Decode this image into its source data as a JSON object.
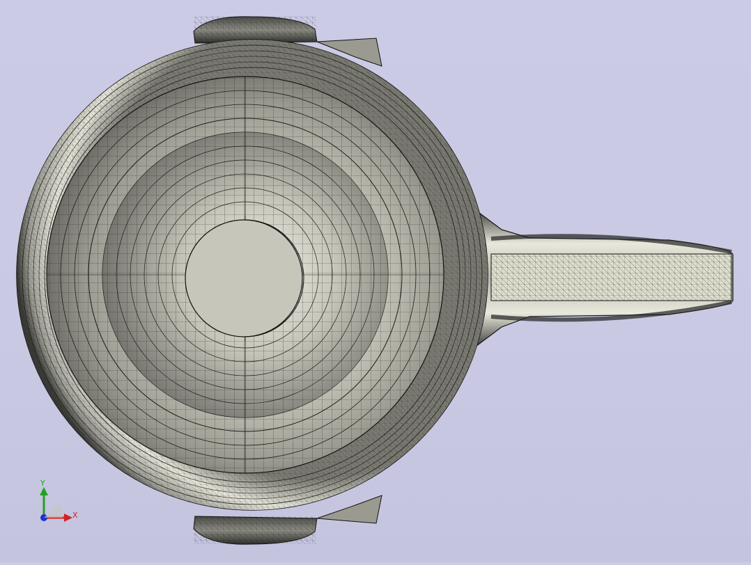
{
  "viewport": {
    "background_color": "#c9c9e3",
    "model_fill": "#c6c6bc",
    "mesh_color": "#1b1b1b",
    "highlight_color": "#f4f4e8"
  },
  "triad": {
    "x_label": "X",
    "y_label": "Y",
    "x_color": "#d42020",
    "y_color": "#22a022",
    "z_color": "#2030d0"
  }
}
